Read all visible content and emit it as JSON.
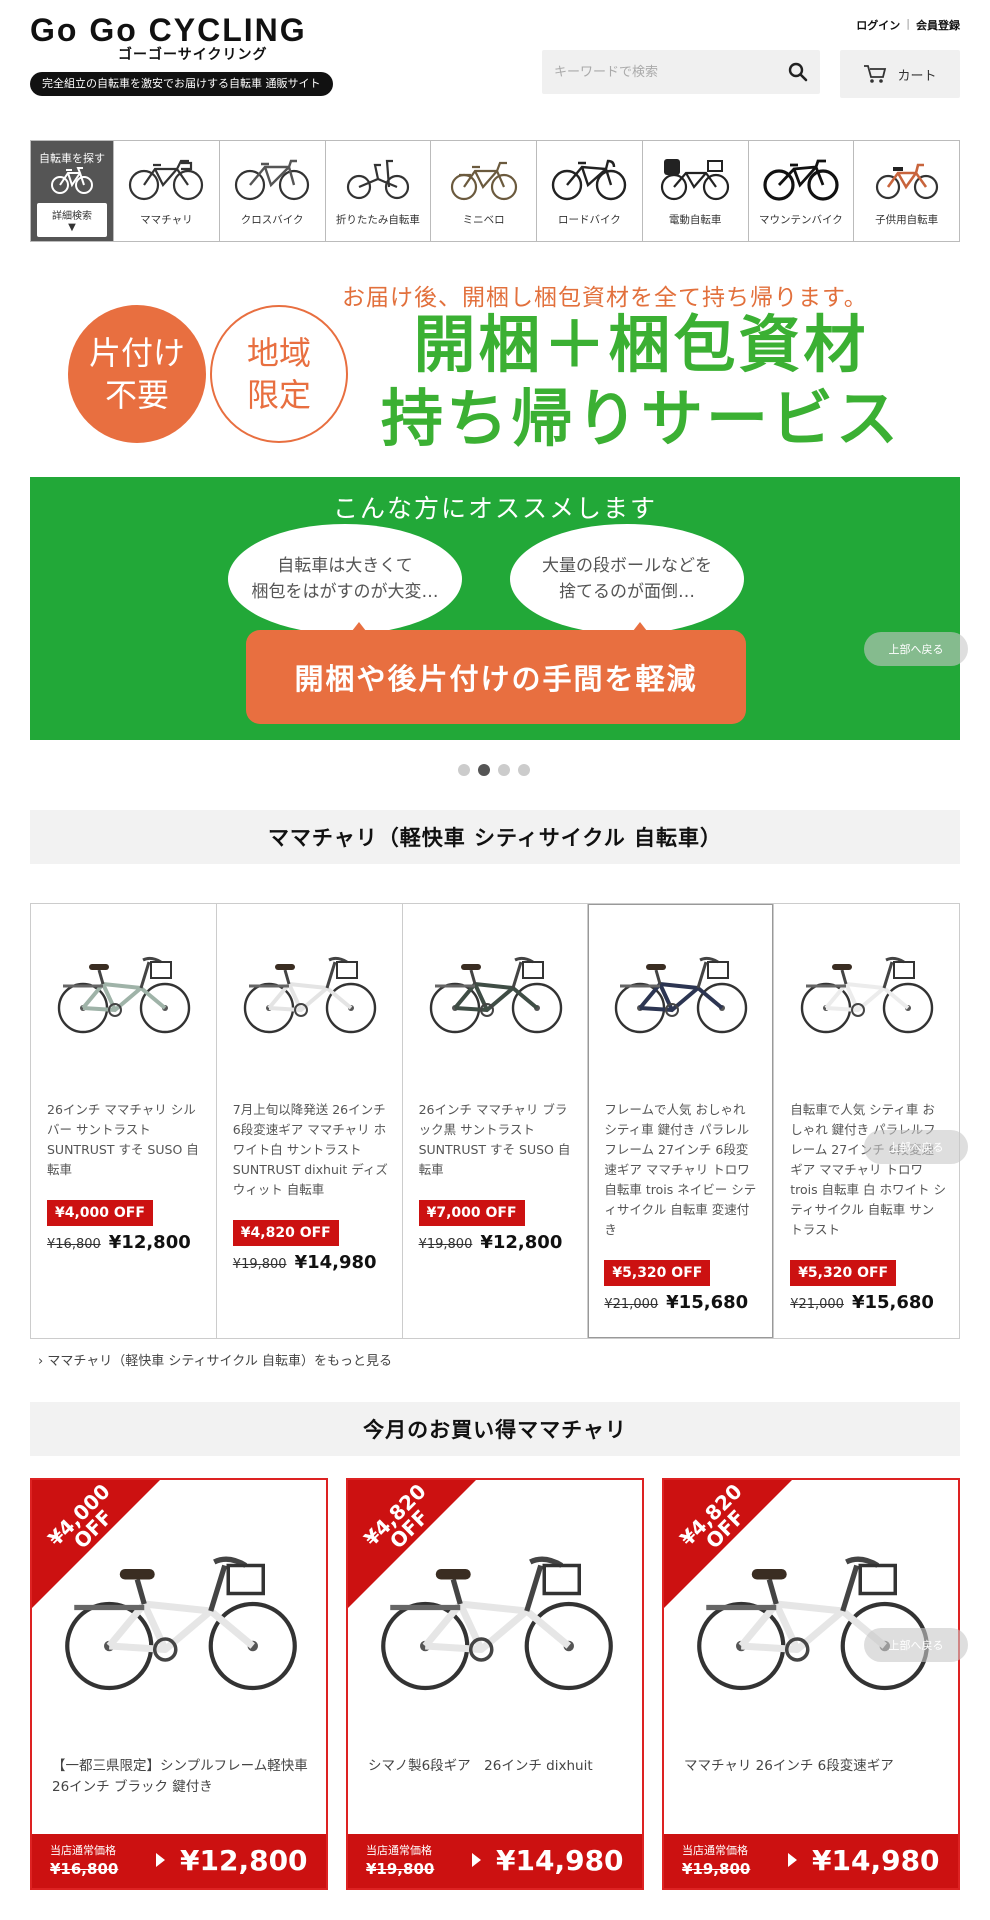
{
  "header": {
    "logo": "Go Go CYCLING",
    "logo_kana": "ゴーゴーサイクリング",
    "tagline": "完全組立の自転車を激安でお届けする自転車 通販サイト",
    "login": "ログイン",
    "separator": "|",
    "register": "会員登録",
    "search_placeholder": "キーワードで検索",
    "cart": "カート"
  },
  "category_nav": {
    "search_label": "自転車を探す",
    "detail_search": "詳細検索",
    "detail_arrow": "▼",
    "items": [
      {
        "label": "ママチャリ"
      },
      {
        "label": "クロスバイク"
      },
      {
        "label": "折りたたみ自転車"
      },
      {
        "label": "ミニベロ"
      },
      {
        "label": "ロードバイク"
      },
      {
        "label": "電動自転車"
      },
      {
        "label": "マウンテンバイク"
      },
      {
        "label": "子供用自転車"
      }
    ]
  },
  "banner": {
    "top_text": "お届け後、開梱し梱包資材を全て持ち帰ります。",
    "circle_a": "片付け\n不要",
    "circle_b": "地域\n限定",
    "main_text": "開梱＋梱包資材\n持ち帰りサービス",
    "recommend_title": "こんな方にオススメします",
    "bubble_a": "自転車は大きくて\n梱包をはがすのが大変…",
    "bubble_b": "大量の段ボールなどを\n捨てるのが面倒…",
    "orange_text": "開梱や後片付けの手間を軽減"
  },
  "back_to_top": "上部へ戻る",
  "carousel": {
    "dots": 4,
    "active_index": 1
  },
  "section1": {
    "title": "ママチャリ（軽快車 シティサイクル 自転車）",
    "more_link": "› ママチャリ（軽快車 シティサイクル 自転車）をもっと見る",
    "products": [
      {
        "name": "26インチ ママチャリ シルバー サントラスト SUNTRUST すそ SUSO 自転車",
        "off": "¥4,000 OFF",
        "old": "¥16,800",
        "new": "¥12,800",
        "color": "#9fb3a8"
      },
      {
        "name": "7月上旬以降発送 26インチ 6段変速ギア ママチャリ ホワイト白 サントラスト SUNTRUST dixhuit ディズウィット 自転車",
        "off": "¥4,820 OFF",
        "old": "¥19,800",
        "new": "¥14,980",
        "color": "#e4e4e4"
      },
      {
        "name": "26インチ ママチャリ ブラック黒 サントラスト SUNTRUST すそ SUSO 自転車",
        "off": "¥7,000 OFF",
        "old": "¥19,800",
        "new": "¥12,800",
        "color": "#3f4d45"
      },
      {
        "name": "フレームで人気 おしゃれ シティ車 鍵付き パラレルフレーム 27インチ 6段変速ギア ママチャリ トロワ 自転車 trois ネイビー シティサイクル 自転車 変速付き",
        "off": "¥5,320 OFF",
        "old": "¥21,000",
        "new": "¥15,680",
        "color": "#2c3552"
      },
      {
        "name": "自転車で人気 シティ車 おしゃれ 鍵付き パラレルフレーム 27インチ 6段変速ギア ママチャリ トロワ trois 自転車 白 ホワイト シティサイクル 自転車 サントラスト",
        "off": "¥5,320 OFF",
        "old": "¥21,000",
        "new": "¥15,680",
        "color": "#ececec"
      }
    ]
  },
  "section2": {
    "title": "今月のお買い得ママチャリ",
    "deals": [
      {
        "ribbon": "¥4,000\nOFF",
        "name": "【一都三県限定】シンプルフレーム軽快車 26インチ ブラック 鍵付き",
        "label": "当店通常価格",
        "old": "¥16,800",
        "new": "¥12,800"
      },
      {
        "ribbon": "¥4,820\nOFF",
        "name": "シマノ製6段ギア　26インチ dixhuit",
        "label": "当店通常価格",
        "old": "¥19,800",
        "new": "¥14,980"
      },
      {
        "ribbon": "¥4,820\nOFF",
        "name": "ママチャリ 26インチ 6段変速ギア",
        "label": "当店通常価格",
        "old": "¥19,800",
        "new": "¥14,980"
      }
    ]
  },
  "colors": {
    "accent_red": "#cc1111",
    "banner_green": "#22a838",
    "banner_orange": "#e86f40",
    "text_green": "#3bb033"
  }
}
